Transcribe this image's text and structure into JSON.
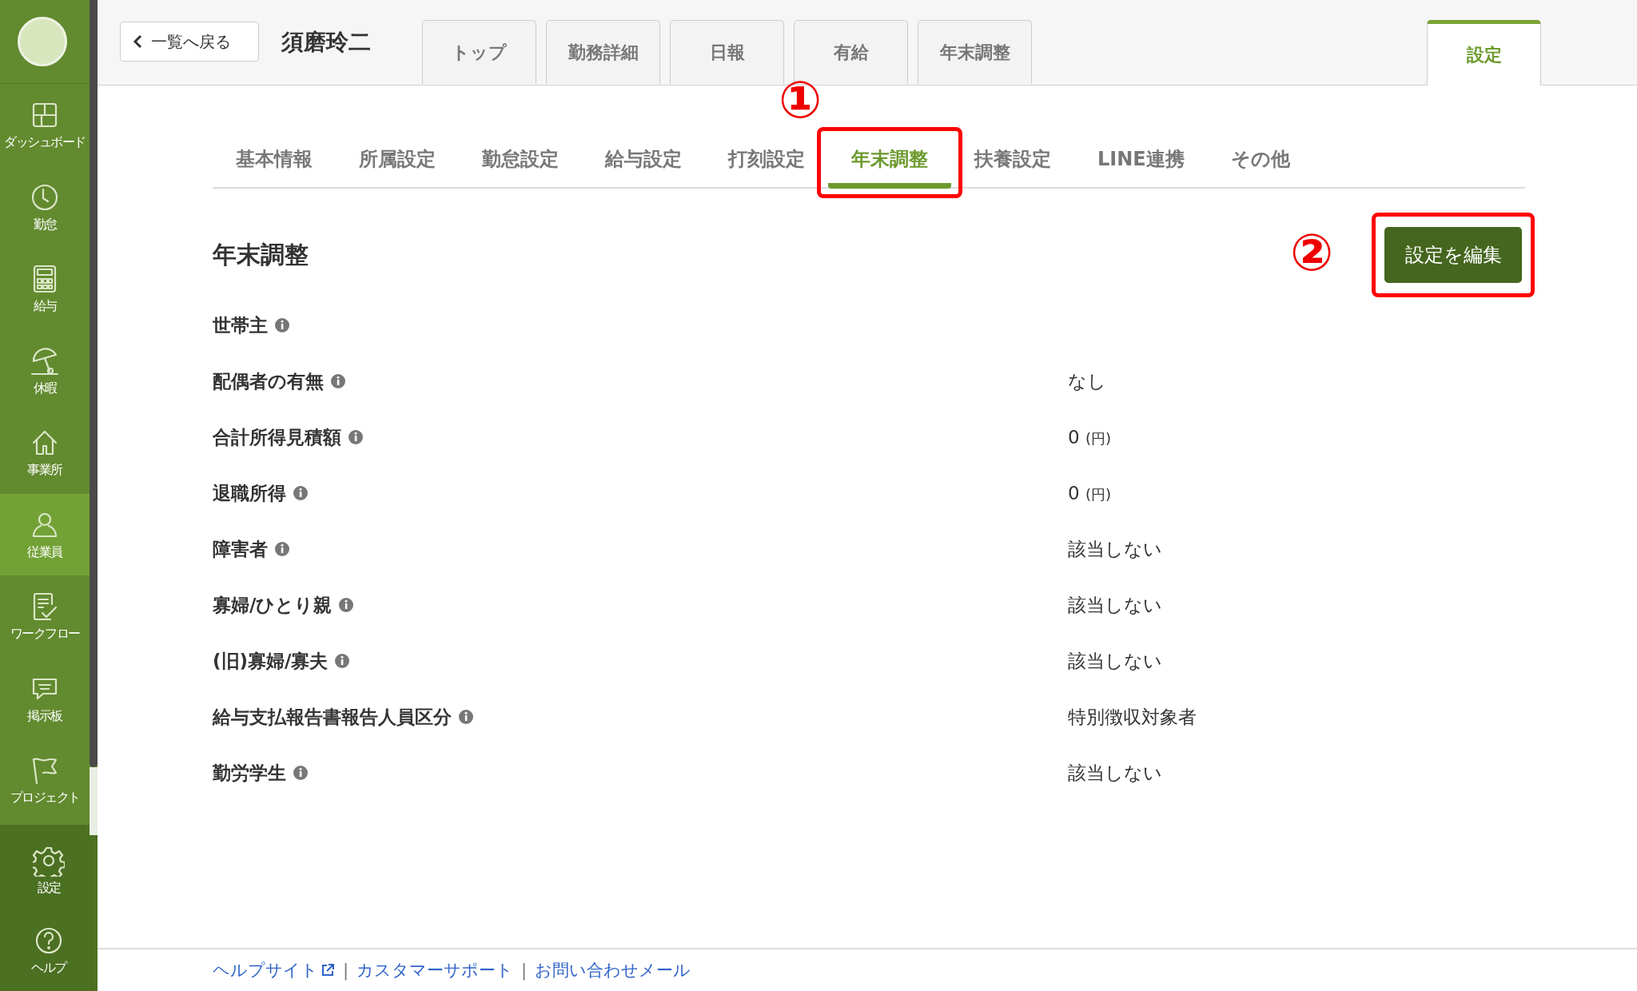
{
  "sidebar": {
    "items": [
      {
        "kind": "dashboard",
        "label": "ダッシュボード",
        "selected": false
      },
      {
        "kind": "clock",
        "label": "勤怠",
        "selected": false
      },
      {
        "kind": "calculator",
        "label": "給与",
        "selected": false
      },
      {
        "kind": "umbrella",
        "label": "休暇",
        "selected": false
      },
      {
        "kind": "house",
        "label": "事業所",
        "selected": false
      },
      {
        "kind": "person",
        "label": "従業員",
        "selected": true
      },
      {
        "kind": "checklist",
        "label": "ワークフロー",
        "selected": false
      },
      {
        "kind": "chat",
        "label": "掲示板",
        "selected": false
      },
      {
        "kind": "flag",
        "label": "プロジェクト",
        "selected": false
      }
    ],
    "bottom_items": [
      {
        "kind": "gear",
        "label": "設定",
        "selected": false
      },
      {
        "kind": "question",
        "label": "ヘルプ",
        "selected": false
      }
    ]
  },
  "header": {
    "back_button": "一覧へ戻る",
    "employee_name": "須磨玲二",
    "tabs": [
      {
        "label": "トップ",
        "selected": false
      },
      {
        "label": "勤務詳細",
        "selected": false
      },
      {
        "label": "日報",
        "selected": false
      },
      {
        "label": "有給",
        "selected": false
      },
      {
        "label": "年末調整",
        "selected": false
      },
      {
        "label": "設定",
        "selected": true
      }
    ]
  },
  "sub_tabs": [
    {
      "label": "基本情報",
      "selected": false
    },
    {
      "label": "所属設定",
      "selected": false
    },
    {
      "label": "勤怠設定",
      "selected": false
    },
    {
      "label": "給与設定",
      "selected": false
    },
    {
      "label": "打刻設定",
      "selected": false
    },
    {
      "label": "年末調整",
      "selected": true,
      "callout": "①"
    },
    {
      "label": "扶養設定",
      "selected": false
    },
    {
      "label": "LINE連携",
      "selected": false
    },
    {
      "label": "その他",
      "selected": false
    }
  ],
  "section": {
    "title": "年末調整",
    "edit_button": {
      "label": "設定を編集",
      "callout": "②"
    },
    "fields": [
      {
        "label": "世帯主"
      },
      {
        "label": "配偶者の有無",
        "value": "なし"
      },
      {
        "label": "合計所得見積額",
        "value": "0",
        "unit": "(円)"
      },
      {
        "label": "退職所得",
        "value": "0",
        "unit": "(円)"
      },
      {
        "label": "障害者",
        "value": "該当しない"
      },
      {
        "label": "寡婦/ひとり親",
        "value": "該当しない"
      },
      {
        "label": "(旧)寡婦/寡夫",
        "value": "該当しない"
      },
      {
        "label": "給与支払報告書報告人員区分",
        "value": "特別徴収対象者"
      },
      {
        "label": "勤労学生",
        "value": "該当しない"
      }
    ]
  },
  "footer": {
    "links": [
      "ヘルプサイト",
      "カスタマーサポート",
      "お問い合わせメール"
    ],
    "separator": "|"
  }
}
